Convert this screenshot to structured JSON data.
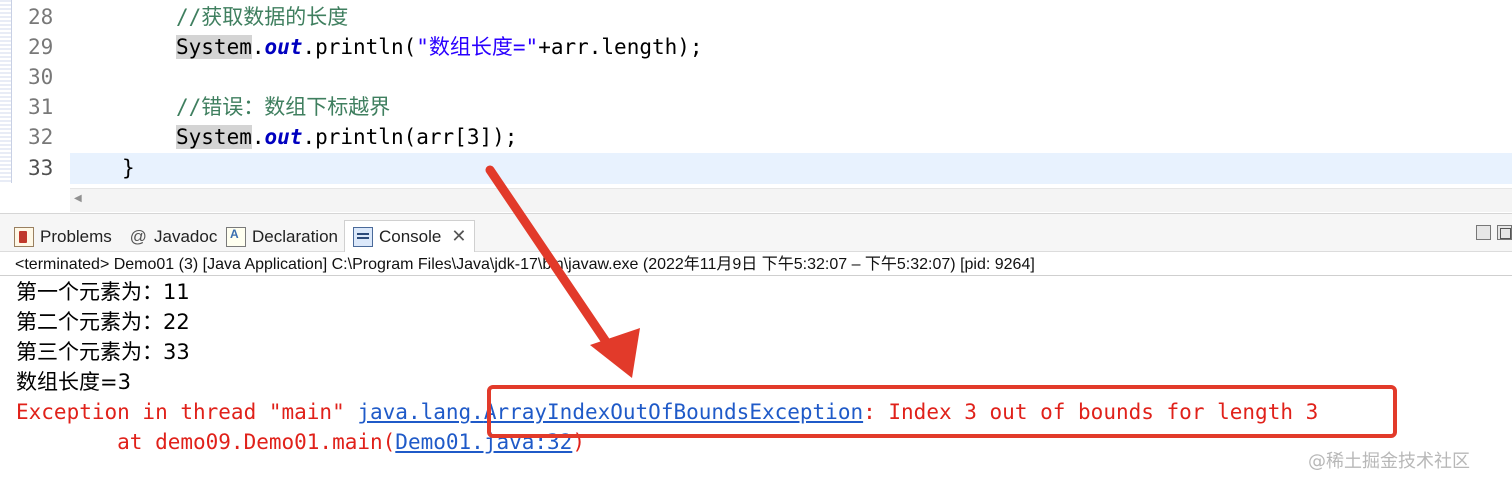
{
  "editor": {
    "lines": [
      {
        "num": "28",
        "comment": "//获取数据的长度"
      },
      {
        "num": "29",
        "sys": "System",
        "dot": ".",
        "field": "out",
        "call": ".println(",
        "str": "\"数组长度=\"",
        "rest": "+arr.length);"
      },
      {
        "num": "30"
      },
      {
        "num": "31",
        "comment": "//错误：数组下标越界"
      },
      {
        "num": "32",
        "sys": "System",
        "dot": ".",
        "field": "out",
        "call": ".println(",
        "rest": "arr[3]);"
      },
      {
        "num": "33",
        "brace": "}"
      }
    ]
  },
  "tabs": [
    {
      "label": "Problems",
      "icon": "problems-icon"
    },
    {
      "label": "Javadoc",
      "icon": "javadoc-icon",
      "glyph": "@"
    },
    {
      "label": "Declaration",
      "icon": "declaration-icon"
    },
    {
      "label": "Console",
      "icon": "console-icon",
      "close": "✕"
    }
  ],
  "status": "<terminated> Demo01 (3) [Java Application] C:\\Program Files\\Java\\jdk-17\\bin\\javaw.exe  (2022年11月9日 下午5:32:07 – 下午5:32:07) [pid: 9264]",
  "console": {
    "output": [
      "第一个元素为：11",
      "第二个元素为：22",
      "第三个元素为：33",
      "数组长度=3"
    ],
    "error": {
      "prefix": "Exception in thread \"main\" ",
      "pkg_link": "java.lang.",
      "exc_link": "ArrayIndexOutOfBoundsException",
      "message": ": Index 3 out of bounds for length 3",
      "trace_prefix": "        at demo09.Demo01.main(",
      "trace_link": "Demo01.java:32",
      "trace_suffix": ")"
    }
  },
  "watermark": "@稀土掘金技术社区",
  "colors": {
    "annotation": "#e23a2a",
    "error": "#e0211a",
    "link": "#1f5ac8",
    "comment": "#3f7f5f"
  }
}
